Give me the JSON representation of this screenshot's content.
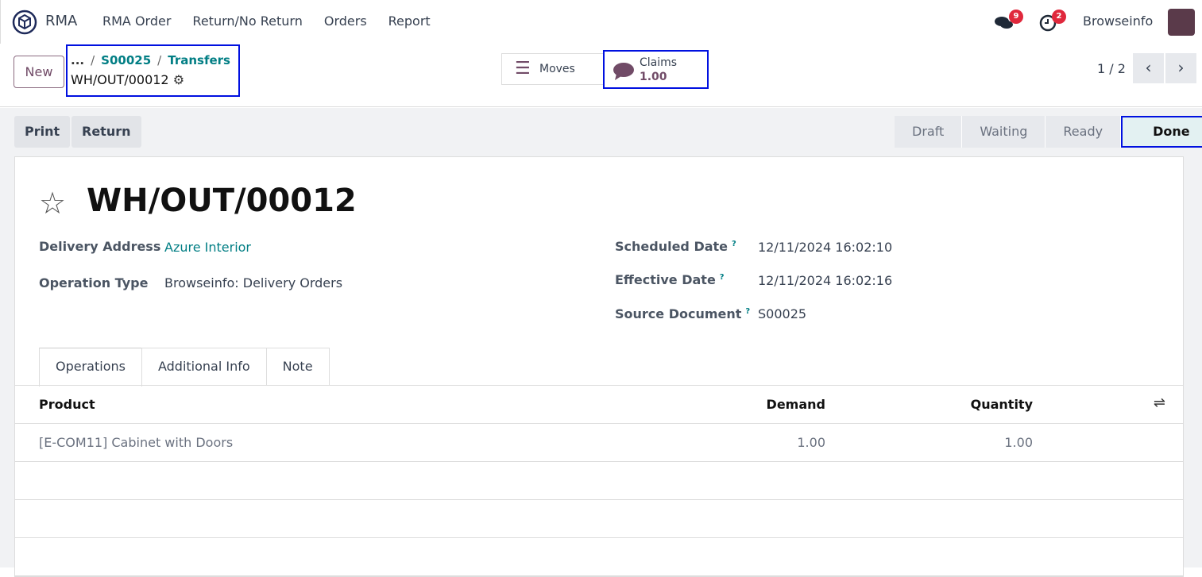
{
  "nav": {
    "app": "RMA",
    "menu": [
      "RMA Order",
      "Return/No Return",
      "Orders",
      "Report"
    ],
    "messages_count": "9",
    "activity_count": "2",
    "user": "Browseinfo"
  },
  "control": {
    "new_label": "New",
    "breadcrumb": {
      "ellipsis": "...",
      "parent": "S00025",
      "current_list": "Transfers",
      "record": "WH/OUT/00012"
    },
    "smart_buttons": {
      "moves": "Moves",
      "claims_label": "Claims",
      "claims_value": "1.00"
    },
    "pager": "1 / 2"
  },
  "actions": {
    "print": "Print",
    "return": "Return"
  },
  "statusbar": [
    "Draft",
    "Waiting",
    "Ready",
    "Done"
  ],
  "form": {
    "title": "WH/OUT/00012",
    "delivery_address_label": "Delivery Address",
    "delivery_address": "Azure Interior",
    "operation_type_label": "Operation Type",
    "operation_type": "Browseinfo: Delivery Orders",
    "scheduled_date_label": "Scheduled Date",
    "scheduled_date": "12/11/2024 16:02:10",
    "effective_date_label": "Effective Date",
    "effective_date": "12/11/2024 16:02:16",
    "source_document_label": "Source Document",
    "source_document": "S00025",
    "help_mark": "?"
  },
  "tabs": [
    "Operations",
    "Additional Info",
    "Note"
  ],
  "table": {
    "headers": {
      "product": "Product",
      "demand": "Demand",
      "quantity": "Quantity"
    },
    "rows": [
      {
        "product": "[E-COM11] Cabinet with Doors",
        "demand": "1.00",
        "quantity": "1.00"
      }
    ]
  }
}
